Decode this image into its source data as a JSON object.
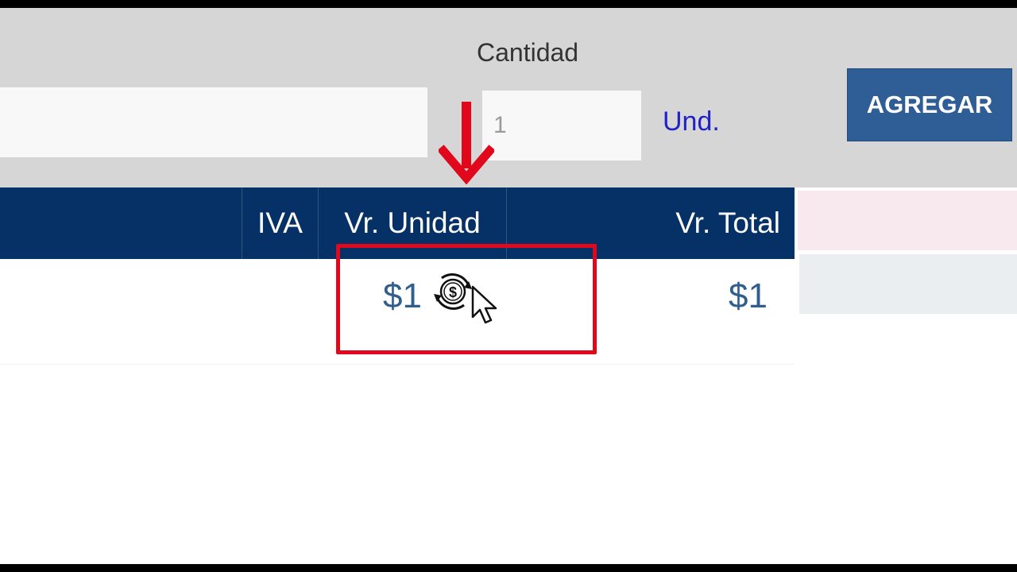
{
  "form": {
    "quantity_label": "Cantidad",
    "quantity_value": "",
    "quantity_placeholder": "1",
    "unit_label": "Und.",
    "product_value": "",
    "add_button_label": "AGREGAR"
  },
  "table": {
    "columns": [
      "",
      "IVA",
      "Vr. Unidad",
      "Vr. Total"
    ],
    "rows": [
      {
        "iva": "",
        "unit_value": "$1",
        "total_value": "$1"
      }
    ]
  },
  "icons": {
    "annotation_arrow": "down-arrow-icon",
    "price_action": "change-price-icon",
    "pointer": "mouse-cursor-icon"
  },
  "colors": {
    "header_bg": "#053166",
    "button_bg": "#2f5e97",
    "unit_text": "#2121c8",
    "value_text": "#2f5e8f",
    "annotation_red": "#e0081a",
    "toolbar_bg": "#d6d6d6"
  }
}
